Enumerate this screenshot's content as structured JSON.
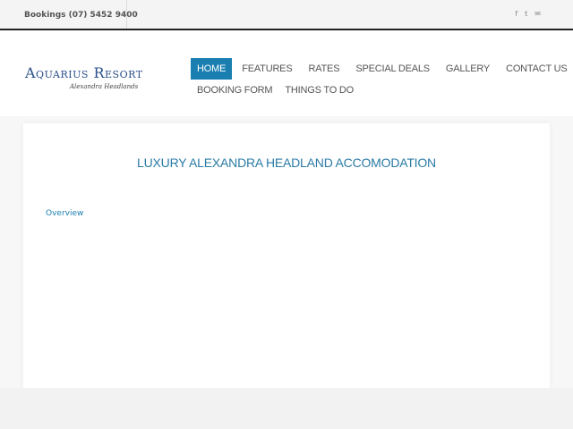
{
  "topbar": {
    "bookings": "Bookings (07) 5452 9400",
    "social": [
      {
        "icon": "facebook-icon",
        "glyph": "f"
      },
      {
        "icon": "twitter-icon",
        "glyph": "t"
      },
      {
        "icon": "email-icon",
        "glyph": "✉"
      }
    ]
  },
  "logo": {
    "main": "Aquarius Resort",
    "sub": "Alexandra Headlands"
  },
  "nav": {
    "row1": [
      "HOME",
      "FEATURES",
      "RATES",
      "SPECIAL DEALS",
      "GALLERY",
      "CONTACT US"
    ],
    "row2": [
      "BOOKING FORM",
      "THINGS TO DO"
    ],
    "active": "HOME"
  },
  "content": {
    "title": "LUXURY ALEXANDRA HEADLAND ACCOMODATION",
    "overview_link": "Overview"
  },
  "colors": {
    "accent": "#1a7fb0",
    "title": "#2a7ba5",
    "logo": "#2a4f8a"
  }
}
